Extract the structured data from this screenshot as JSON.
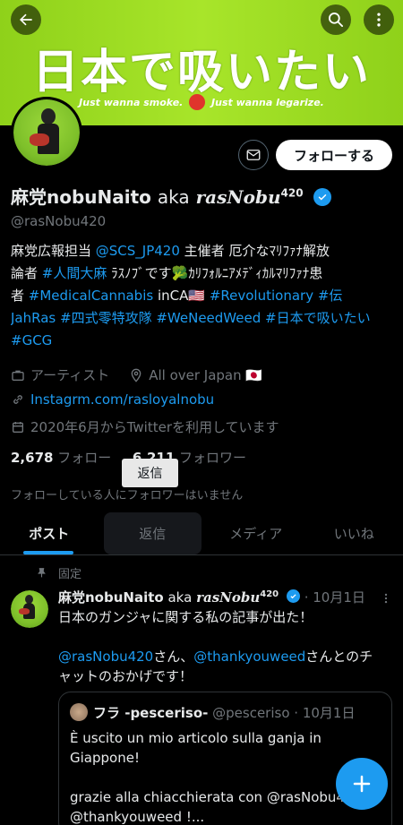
{
  "banner": {
    "title": "日本で吸いたい",
    "subtitle_left": "Just wanna smoke.",
    "subtitle_right": "Just wanna legarize."
  },
  "profile": {
    "name": "麻党nobuNaito",
    "name_tail": "aka",
    "name_styled": "rasNobu",
    "name_sup": "420",
    "handle": "@rasNobu420",
    "follow_label": "フォローする",
    "bio": {
      "l1a": "麻党広報担当 ",
      "l1b": "@SCS_JP420",
      "l1c": " 主催者 厄介なﾏﾘﾌｧﾅ解放",
      "l2a": "論者 ",
      "l2b": "#人間大麻",
      "l2c": " ﾗｽﾉﾌﾞです🥦ｶﾘﾌｫﾙﾆｱﾒﾃﾞｨｶﾙﾏﾘﾌｧﾅ患",
      "l3a": "者 ",
      "l3b": "#MedicalCannabis",
      "l3c": " inCA🇺🇸  ",
      "l3d": "#Revolutionary",
      "l3e": " ",
      "l3f": "#伝",
      "l4a": "JahRas",
      "l4b": " #四式零特攻隊",
      "l4c": " #WeNeedWeed",
      "l4d": " #日本で吸いたい",
      "l5a": "#GCG"
    },
    "category": "アーティスト",
    "location": "All over Japan 🇯🇵",
    "website": "Instagrm.com/rasloyalnobu",
    "joined": "2020年6月からTwitterを利用しています",
    "following_count": "2,678",
    "following_label": "フォロー",
    "followers_count": "6,211",
    "followers_label": "フォロワー",
    "mutuals": "フォローしている人にフォロワーはいません"
  },
  "tooltip": "返信",
  "tabs": [
    "ポスト",
    "返信",
    "メディア",
    "いいね"
  ],
  "pinned_label": "固定",
  "tweet": {
    "name": "麻党nobuNaito",
    "name_tail": "aka",
    "name_styled": "rasNobu",
    "name_sup": "420",
    "date": "· 10月1日",
    "line1": "日本のガンジャに関する私の記事が出た！",
    "mention1": "@rasNobu420",
    "mid": "さん、",
    "mention2": "@thankyouweed",
    "tail": "さんとのチ",
    "line4": "ャットのおかげです！"
  },
  "quote": {
    "name": "フラ -pesceriso-",
    "handle": "@pesceriso",
    "date": "· 10月1日",
    "l1": "È uscito un mio articolo sulla ganja in",
    "l2": "Giappone!",
    "l3": "grazie alla chiacchierata con @rasNobu420",
    "l4": "@thankyouweed !..."
  },
  "colors": {
    "accent": "#1d9bf0",
    "banner": "#8fd11a"
  },
  "icons": [
    "back-arrow-icon",
    "search-icon",
    "more-vertical-icon",
    "mail-icon",
    "verified-icon",
    "briefcase-icon",
    "location-pin-icon",
    "link-icon",
    "calendar-icon",
    "pin-icon",
    "more-horizontal-icon",
    "plus-icon"
  ]
}
